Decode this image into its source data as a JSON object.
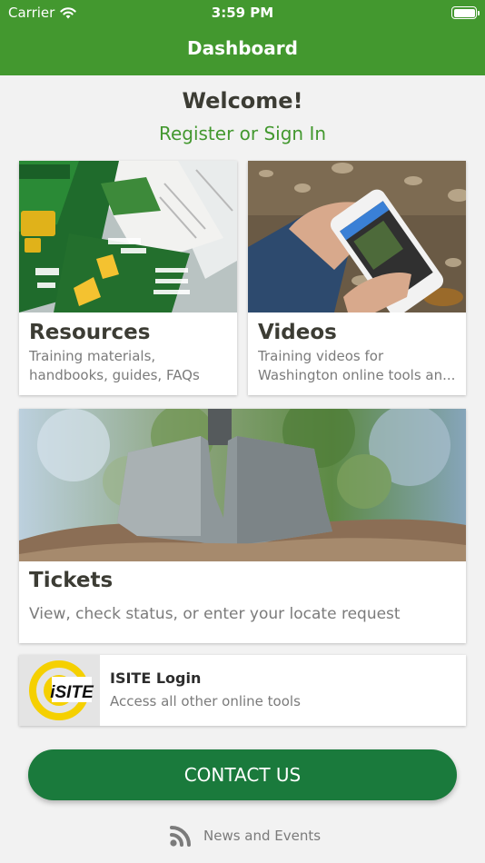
{
  "status_bar": {
    "carrier": "Carrier",
    "time": "3:59 PM"
  },
  "nav": {
    "title": "Dashboard"
  },
  "welcome": {
    "heading": "Welcome!",
    "signin_link": "Register or Sign In"
  },
  "cards": {
    "resources": {
      "title": "Resources",
      "description": "Training materials, handbooks, guides, FAQs"
    },
    "videos": {
      "title": "Videos",
      "description": "Training videos for Washington online tools an..."
    },
    "tickets": {
      "title": "Tickets",
      "description": "View, check status, or enter your locate request"
    }
  },
  "isite": {
    "logo_text": "iSITE",
    "title": "ISITE Login",
    "subtitle": "Access all other online tools"
  },
  "contact_button": {
    "label": "CONTACT US"
  },
  "news": {
    "label": "News and Events",
    "icon": "rss-icon"
  },
  "colors": {
    "header": "#43982f",
    "link": "#43982f",
    "contact_button": "#1a7a3c",
    "logo_yellow": "#f5d000"
  }
}
